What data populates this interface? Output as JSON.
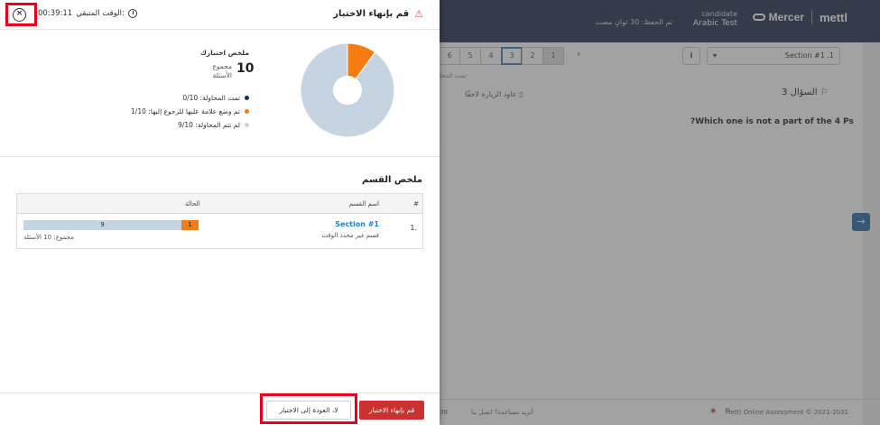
{
  "background": {
    "brand": {
      "mercer": "Mercer",
      "metti": "mettl"
    },
    "candidate": {
      "label": "candidate",
      "test": "Arabic Test"
    },
    "saved_status": "تم الحفظ: 30 ثوانِ مضت",
    "pages": [
      "6",
      "5",
      "4",
      "3",
      "2",
      "1"
    ],
    "section_select": "Section #1 .1",
    "info_icon_text": "i",
    "attempted_tab": "تمت المحا",
    "bookmark_label": "عاود الزيارة لاحقًا",
    "question_number": "السؤال 3",
    "question_text": "?Which one is not a part of the 4 Ps",
    "footer": {
      "num": "38",
      "help": "أتريد مساعدة؟ اتصل بنا",
      "copyright": "Mettl Online Assessment © 2021-2031"
    }
  },
  "dialog": {
    "title": "قم بإنهاء الاختبار",
    "timer_label": "الوقت المتبقي:",
    "timer_value": "00:39:11",
    "summary": {
      "heading": "ملخص اختبارك",
      "total_number": "10",
      "total_label": "مجموع الأسئلة",
      "legend": [
        {
          "label": "تمت المحاولة: 0/10",
          "color": "#1f2d4f"
        },
        {
          "label": "تم وضع علامة عليها للرجوع إليها: 1/10",
          "color": "#f47c12"
        },
        {
          "label": "لم تتم المحاولة: 9/10",
          "color": "#c6d4e2"
        }
      ]
    },
    "section_summary": {
      "heading": "ملخص القسم",
      "columns": {
        "num": "#",
        "name": "اسم القسم",
        "status": "الحالة"
      },
      "rows": [
        {
          "num": "1.",
          "name": "Section #1",
          "sub": "قسم غير محدد الوقت",
          "marked": "1",
          "unattempted": "9",
          "total": "مجموع: 10 الأسئلة"
        }
      ]
    },
    "buttons": {
      "submit": "قم بإنهاء الاختبار",
      "back": "لا، العودة إلى الاختبار"
    }
  },
  "chart_data": {
    "type": "pie",
    "slices": [
      {
        "label": "تمت المحاولة",
        "value": 0,
        "color": "#1f2d4f"
      },
      {
        "label": "تم وضع علامة عليها للرجوع إليها",
        "value": 1,
        "color": "#f47c12"
      },
      {
        "label": "لم تتم المحاولة",
        "value": 9,
        "color": "#c6d4e2"
      }
    ],
    "total": 10
  }
}
